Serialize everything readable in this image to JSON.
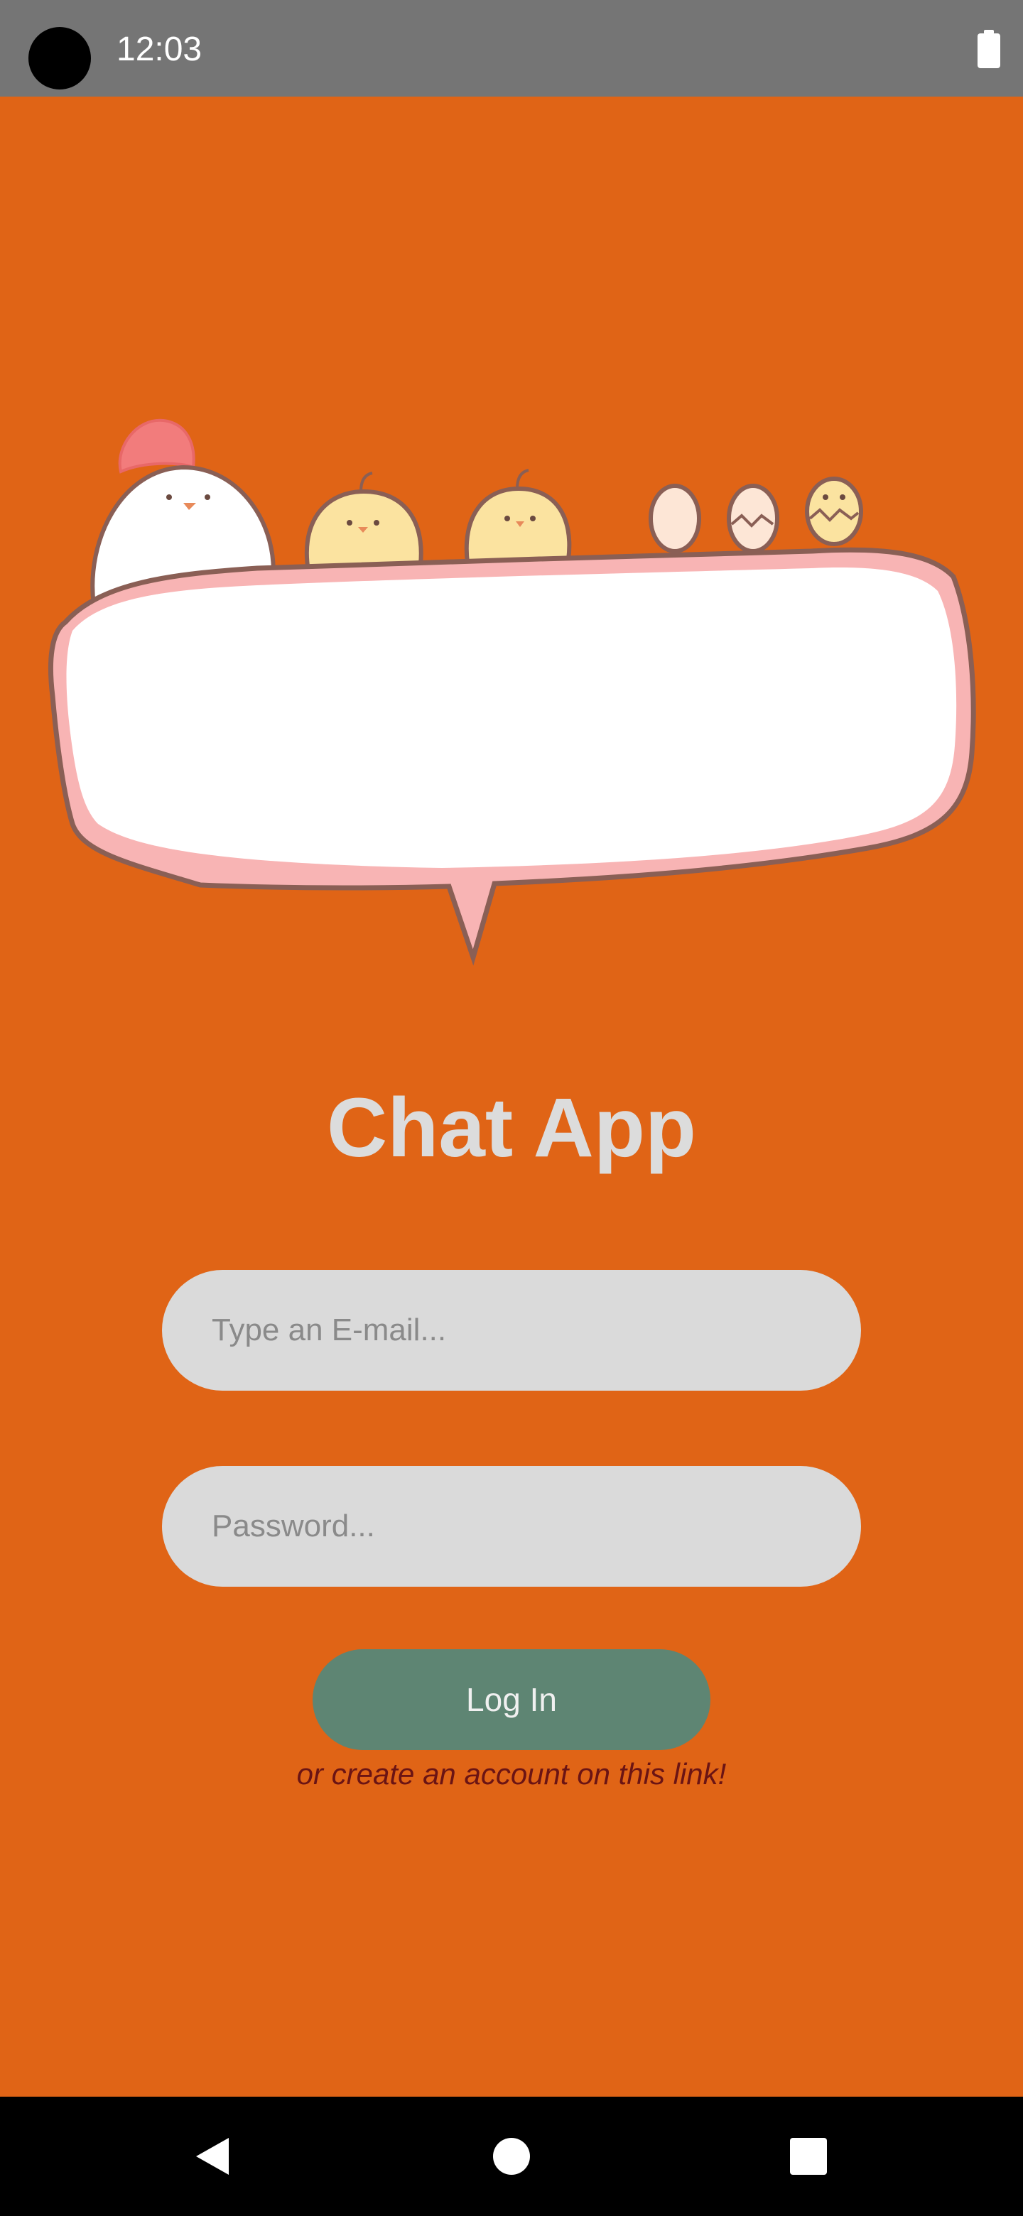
{
  "status_bar": {
    "time": "12:03",
    "battery_icon": "battery-full-icon"
  },
  "illustration": {
    "icon": "chicken-family-speech-bubble-illustration"
  },
  "app": {
    "title": "Chat App"
  },
  "form": {
    "email_placeholder": "Type an E-mail...",
    "email_value": "",
    "password_placeholder": "Password...",
    "password_value": "",
    "login_label": "Log In",
    "create_account_text": "or create an account on this link!"
  },
  "nav": {
    "back_icon": "back-triangle-icon",
    "home_icon": "home-circle-icon",
    "recents_icon": "recents-square-icon"
  },
  "colors": {
    "background": "#E06416",
    "status_bar": "#757575",
    "title": "#DCDCDC",
    "input_bg": "#DADADA",
    "button_bg": "#5E8573",
    "link_text": "#6B1414"
  }
}
